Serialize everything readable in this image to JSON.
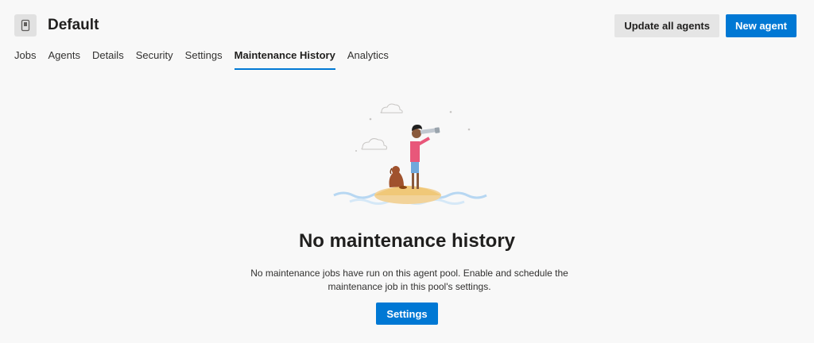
{
  "header": {
    "title": "Default",
    "icon": "agent-pool-icon",
    "update_all_label": "Update all agents",
    "new_agent_label": "New agent"
  },
  "tabs": [
    {
      "label": "Jobs",
      "selected": false
    },
    {
      "label": "Agents",
      "selected": false
    },
    {
      "label": "Details",
      "selected": false
    },
    {
      "label": "Security",
      "selected": false
    },
    {
      "label": "Settings",
      "selected": false
    },
    {
      "label": "Maintenance History",
      "selected": true
    },
    {
      "label": "Analytics",
      "selected": false
    }
  ],
  "empty_state": {
    "title": "No maintenance history",
    "description": "No maintenance jobs have run on this agent pool. Enable and schedule the maintenance job in this pool's settings.",
    "button_label": "Settings",
    "illustration": "person-with-telescope-and-dog-on-island"
  },
  "colors": {
    "accent": "#0078d4",
    "background": "#f8f8f8",
    "secondary_button": "#e5e5e5"
  }
}
